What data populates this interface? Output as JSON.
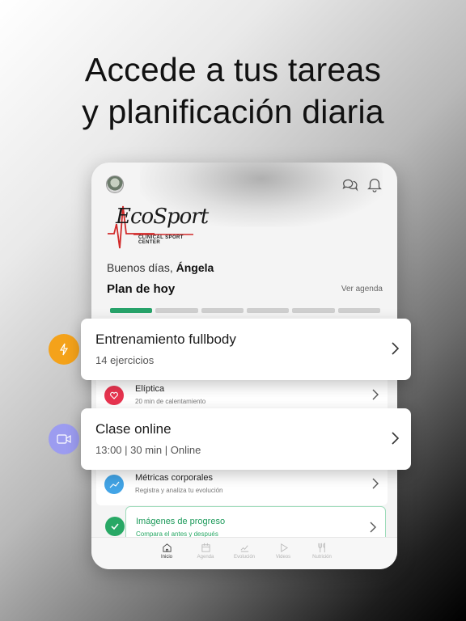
{
  "headline": {
    "line1": "Accede a tus tareas",
    "line2": "y planificación diaria"
  },
  "app": {
    "logo_text": "EcoSport",
    "logo_sub": "CLINICAL SPORT CENTER",
    "greeting_prefix": "Buenos días, ",
    "greeting_name": "Ángela",
    "plan_title": "Plan de hoy",
    "see_agenda": "Ver agenda",
    "progress_segments": 6,
    "progress_completed": 1,
    "icons": [
      "avatar",
      "chat-icon",
      "bell-icon"
    ]
  },
  "cards": [
    {
      "title": "Entrenamiento fullbody",
      "subtitle": "14 ejercicios",
      "icon": "lightning-icon",
      "color": "#f4a21a"
    },
    {
      "title": "Clase online",
      "subtitle": "13:00 | 30 min | Online",
      "icon": "video-icon",
      "color": "#9c9cf0"
    }
  ],
  "list": [
    {
      "title": "Elíptica",
      "subtitle": "20 min de calentamiento",
      "icon": "heart-icon",
      "color": "#e8344f"
    },
    {
      "title": "Métricas corporales",
      "subtitle": "Registra y analiza tu evolución",
      "icon": "chart-icon",
      "color": "#42a4e6"
    },
    {
      "title": "Imágenes de progreso",
      "subtitle": "Compara el antes y después",
      "icon": "check-icon",
      "color": "#28a865",
      "done": true
    }
  ],
  "nav": [
    {
      "label": "Inicio",
      "icon": "home-icon",
      "active": true
    },
    {
      "label": "Agenda",
      "icon": "calendar-icon",
      "active": false
    },
    {
      "label": "Evolución",
      "icon": "trend-icon",
      "active": false
    },
    {
      "label": "Videos",
      "icon": "play-icon",
      "active": false
    },
    {
      "label": "Nutrición",
      "icon": "cutlery-icon",
      "active": false
    }
  ],
  "colors": {
    "accent_green": "#27a36a",
    "orange": "#f4a21a",
    "lavender": "#9c9cf0"
  }
}
